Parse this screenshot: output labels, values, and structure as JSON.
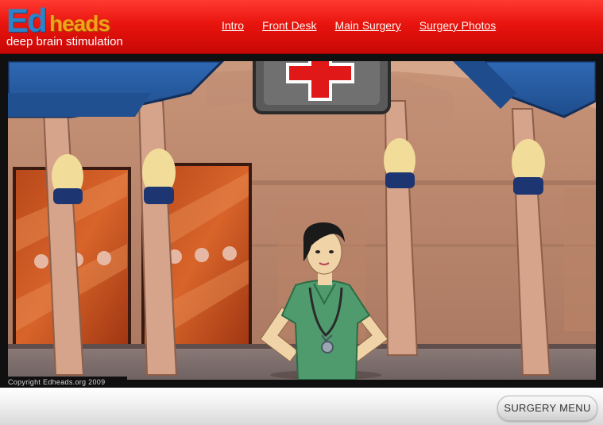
{
  "header": {
    "logo_text": "Edheads",
    "logo_ed": "Ed",
    "logo_heads": "heads",
    "subtitle": "deep brain stimulation",
    "nav": [
      {
        "label": "Intro"
      },
      {
        "label": "Front Desk"
      },
      {
        "label": "Main Surgery"
      },
      {
        "label": "Surgery Photos"
      }
    ]
  },
  "stage": {
    "copyright": "Copyright Edheads.org 2009"
  },
  "footer": {
    "menu_button": "SURGERY MENU"
  },
  "colors": {
    "header_red": "#e8140e",
    "logo_blue": "#2c83c8",
    "logo_orange": "#f4a21a",
    "scrubs_green": "#4f9b6e",
    "awning_blue": "#2b5fa6"
  }
}
